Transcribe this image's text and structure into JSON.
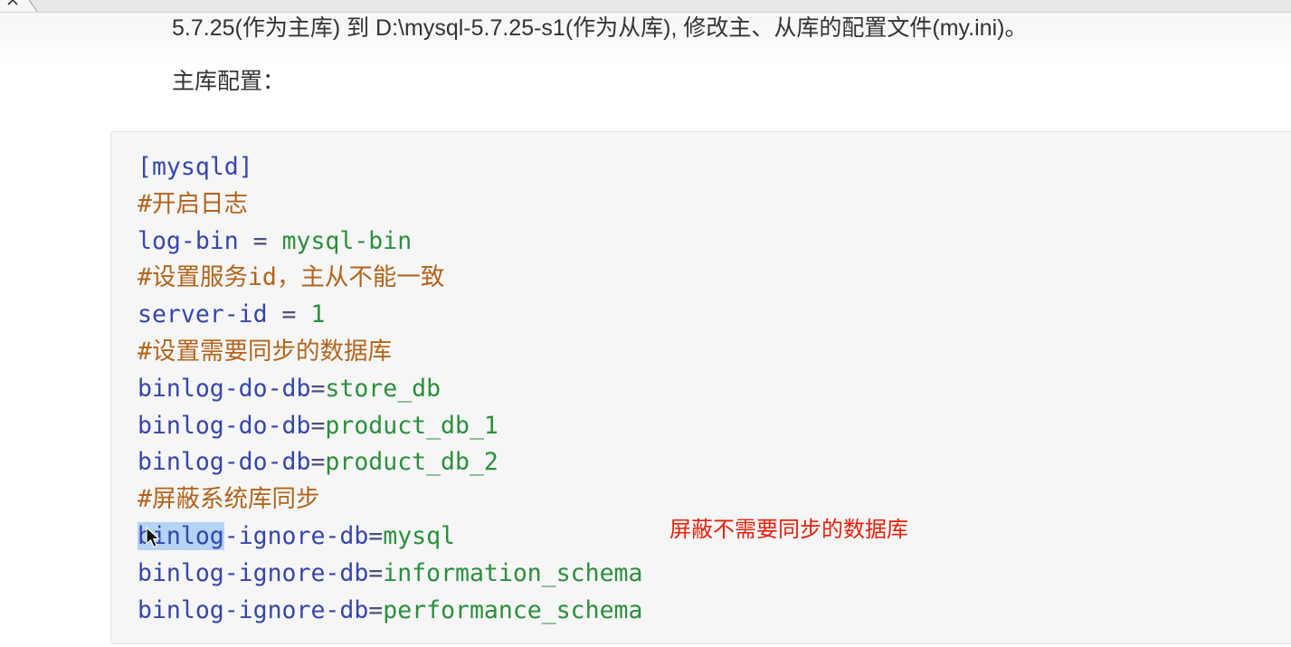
{
  "tab": {
    "close_icon": "close-icon"
  },
  "intro_line": "5.7.25(作为主库) 到 D:\\mysql-5.7.25-s1(作为从库), 修改主、从库的配置文件(my.ini)。",
  "section_title": "主库配置：",
  "code": {
    "lines": [
      {
        "header": "[mysqld]"
      },
      {
        "comment": "#开启日志"
      },
      {
        "key": "log-bin",
        "op": " = ",
        "value": "mysql-bin"
      },
      {
        "comment": "#设置服务id，主从不能一致"
      },
      {
        "key": "server-id",
        "op": " = ",
        "value": "1"
      },
      {
        "comment": "#设置需要同步的数据库"
      },
      {
        "key": "binlog-do-db",
        "op": "=",
        "value": "store_db"
      },
      {
        "key": "binlog-do-db",
        "op": "=",
        "value": "product_db_1"
      },
      {
        "key": "binlog-do-db",
        "op": "=",
        "value": "product_db_2"
      },
      {
        "comment": "#屏蔽系统库同步"
      },
      {
        "key_selected": "binlog",
        "key_rest": "-ignore-db",
        "op": "=",
        "value": "mysql"
      },
      {
        "key": "binlog-ignore-db",
        "op": "=",
        "value": "information_schema"
      },
      {
        "key": "binlog-ignore-db",
        "op": "=",
        "value": "performance_schema"
      }
    ]
  },
  "annotation": {
    "text": "屏蔽不需要同步的数据库"
  },
  "cursor": {
    "icon": "mouse-pointer-icon"
  },
  "colors": {
    "keyword": "#3546ad",
    "comment": "#b3641b",
    "value": "#2b8f3a",
    "operator": "#4a4f7a",
    "annotation": "#e8200a",
    "selection": "#b5d3f2",
    "body_text": "#333333",
    "code_background": "#f6f6f7"
  }
}
